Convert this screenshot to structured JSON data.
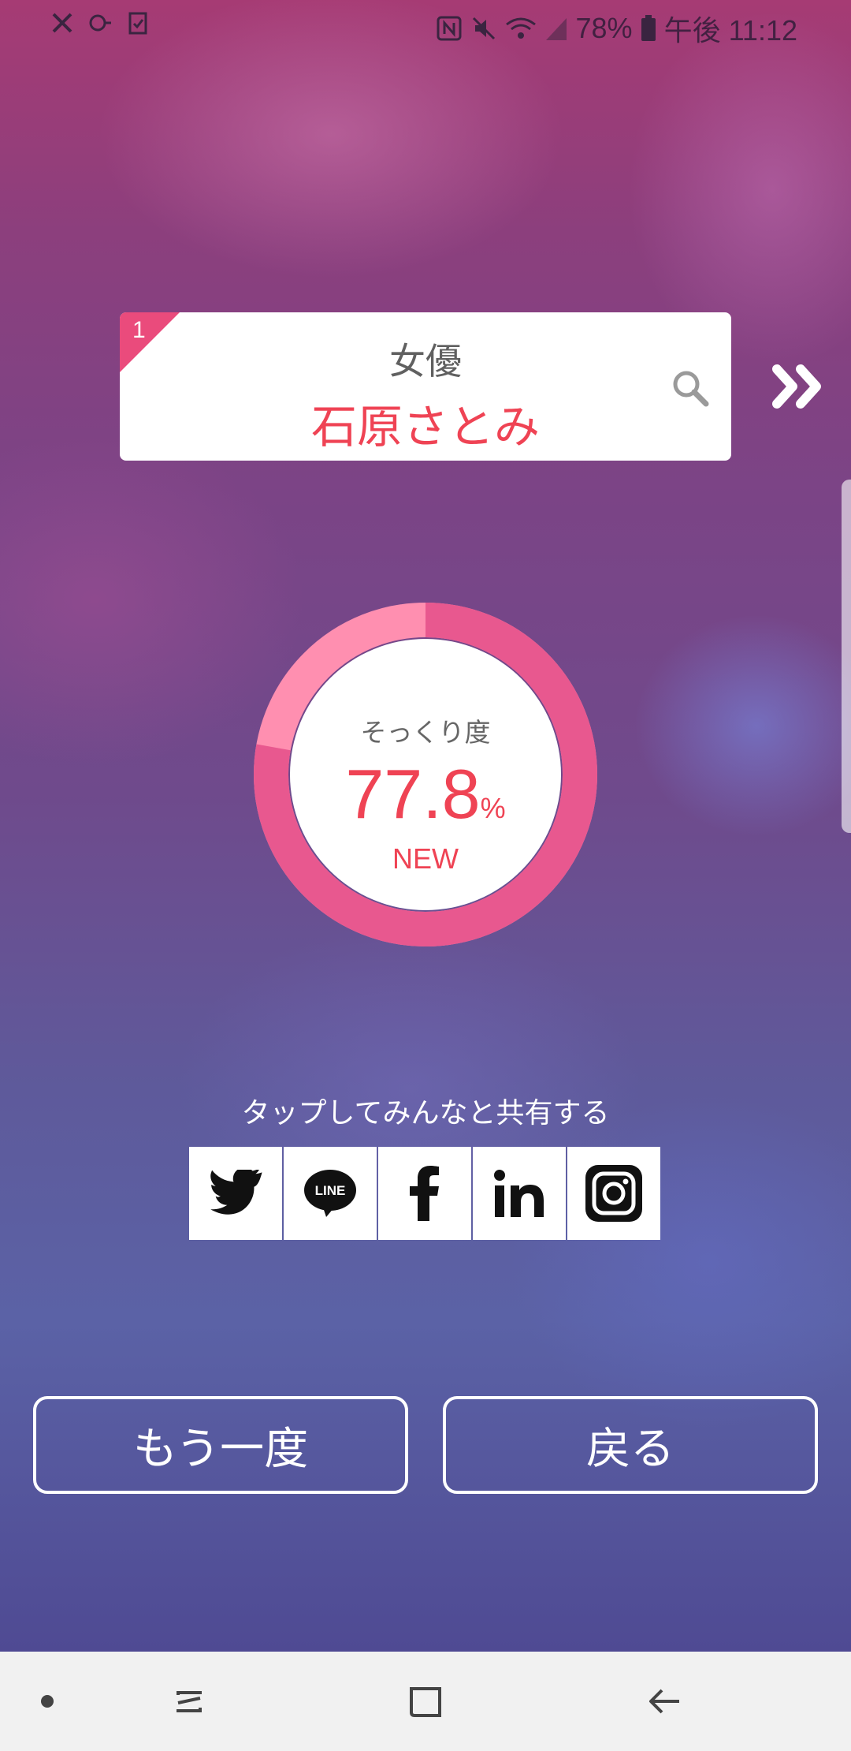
{
  "status_bar": {
    "battery": "78%",
    "time": "午後 11:12",
    "icons": [
      "tools-icon",
      "key-icon",
      "clipboard-check-icon",
      "nfc-icon",
      "mute-icon",
      "wifi-icon",
      "signal-icon",
      "battery-icon"
    ]
  },
  "result": {
    "rank": "1",
    "category": "女優",
    "name": "石原さとみ"
  },
  "score": {
    "label": "そっくり度",
    "value": "77.8",
    "unit": "%",
    "badge": "NEW",
    "fraction": 0.778
  },
  "share": {
    "caption": "タップしてみんなと共有する",
    "services": [
      "twitter",
      "line",
      "facebook",
      "linkedin",
      "instagram"
    ],
    "line_text": "LINE"
  },
  "actions": {
    "retry_label": "もう一度",
    "back_label": "戻る"
  },
  "colors": {
    "accent_red": "#ef4354",
    "ring_pink": "#e8588f",
    "ring_light": "#ff8fb0",
    "rank_pink": "#ea4b7c"
  }
}
